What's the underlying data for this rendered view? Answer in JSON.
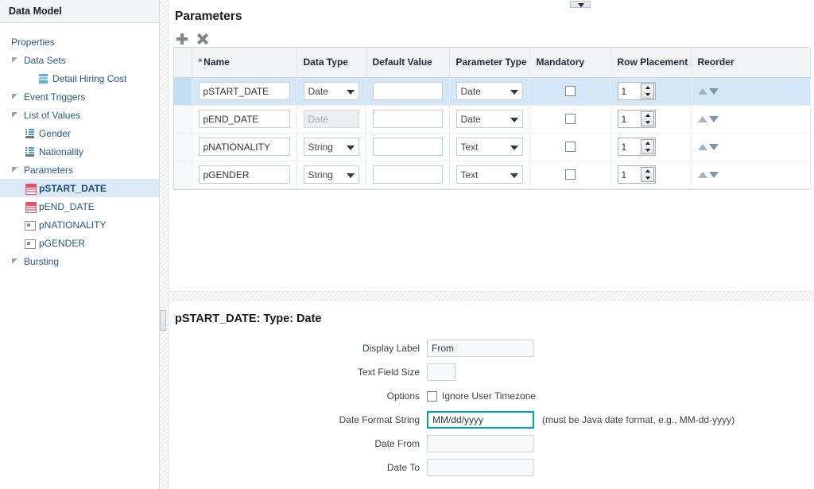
{
  "sidebar": {
    "header_title": "Data Model",
    "tree": [
      {
        "label": "Properties",
        "indent": 1,
        "twisty": false,
        "icon": null,
        "selected": false
      },
      {
        "label": "Data Sets",
        "indent": 1,
        "twisty": true,
        "icon": null,
        "selected": false
      },
      {
        "label": "Detail Hiring Cost",
        "indent": 3,
        "twisty": false,
        "icon": "dataset-icon",
        "selected": false
      },
      {
        "label": "Event Triggers",
        "indent": 1,
        "twisty": true,
        "icon": null,
        "selected": false
      },
      {
        "label": "List of Values",
        "indent": 1,
        "twisty": true,
        "icon": null,
        "selected": false
      },
      {
        "label": "Gender",
        "indent": 2,
        "twisty": false,
        "icon": "list-of-values-icon",
        "selected": false
      },
      {
        "label": "Nationality",
        "indent": 2,
        "twisty": false,
        "icon": "list-of-values-icon",
        "selected": false
      },
      {
        "label": "Parameters",
        "indent": 1,
        "twisty": true,
        "icon": null,
        "selected": false
      },
      {
        "label": "pSTART_DATE",
        "indent": 2,
        "twisty": false,
        "icon": "calendar-icon",
        "selected": true
      },
      {
        "label": "pEND_DATE",
        "indent": 2,
        "twisty": false,
        "icon": "calendar-icon",
        "selected": false
      },
      {
        "label": "pNATIONALITY",
        "indent": 2,
        "twisty": false,
        "icon": "text-field-icon",
        "selected": false
      },
      {
        "label": "pGENDER",
        "indent": 2,
        "twisty": false,
        "icon": "text-field-icon",
        "selected": false
      },
      {
        "label": "Bursting",
        "indent": 1,
        "twisty": true,
        "icon": null,
        "selected": false
      }
    ]
  },
  "parameters_panel": {
    "title": "Parameters",
    "toolbar": {
      "add_label": "+",
      "delete_label": "×"
    },
    "columns": [
      "",
      "Name",
      "Data Type",
      "Default Value",
      "Parameter Type",
      "Mandatory",
      "Row Placement",
      "Reorder"
    ],
    "name_required_marker": "*",
    "rows": [
      {
        "name": "pSTART_DATE",
        "data_type": "Date",
        "data_type_disabled": false,
        "default_value": "",
        "parameter_type": "Date",
        "mandatory": false,
        "row_placement": "1",
        "selected": true
      },
      {
        "name": "pEND_DATE",
        "data_type": "Date",
        "data_type_disabled": true,
        "default_value": "",
        "parameter_type": "Date",
        "mandatory": false,
        "row_placement": "1",
        "selected": false
      },
      {
        "name": "pNATIONALITY",
        "data_type": "String",
        "data_type_disabled": false,
        "default_value": "",
        "parameter_type": "Text",
        "mandatory": false,
        "row_placement": "1",
        "selected": false
      },
      {
        "name": "pGENDER",
        "data_type": "String",
        "data_type_disabled": false,
        "default_value": "",
        "parameter_type": "Text",
        "mandatory": false,
        "row_placement": "1",
        "selected": false
      }
    ]
  },
  "detail_panel": {
    "title": "pSTART_DATE: Type: Date",
    "fields": {
      "display_label": {
        "label": "Display Label",
        "value": "From"
      },
      "text_field_size": {
        "label": "Text Field Size",
        "value": ""
      },
      "options": {
        "label": "Options",
        "checkbox_label": "Ignore User Timezone",
        "checked": false
      },
      "date_format_string": {
        "label": "Date Format String",
        "value": "MM/dd/yyyy",
        "hint": "(must be Java date format, e.g., MM-dd-yyyy)"
      },
      "date_from": {
        "label": "Date From",
        "value": ""
      },
      "date_to": {
        "label": "Date To",
        "value": ""
      }
    }
  },
  "colors": {
    "accent_focus": "#00a6a6",
    "selection_row": "#d3e7f8",
    "tree_link": "#26588e",
    "date_icon": "#e0536b"
  }
}
